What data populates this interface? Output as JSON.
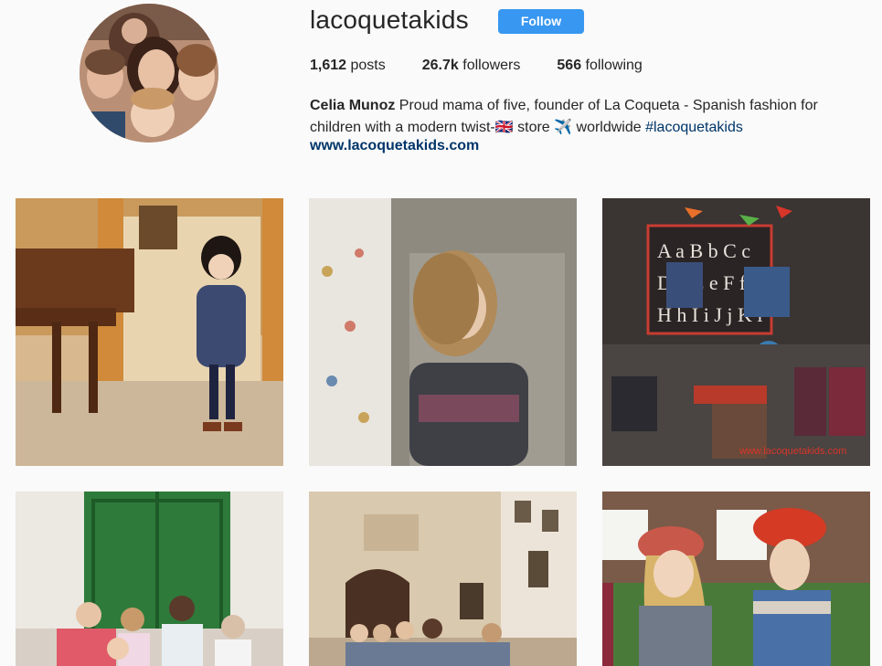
{
  "profile": {
    "username": "lacoquetakids",
    "follow_label": "Follow",
    "stats": [
      {
        "value": "1,612",
        "label": "posts"
      },
      {
        "value": "26.7k",
        "label": "followers"
      },
      {
        "value": "566",
        "label": "following"
      }
    ],
    "bio": {
      "name": "Celia Munoz",
      "text_1": "Proud mama of five, founder of La Coqueta - Spanish fashion for children with a modern twist-",
      "flag": "🇬🇧",
      "text_2": " store ",
      "plane": "✈️",
      "text_3": "  worldwide ",
      "hashtag": "#lacoquetakids"
    },
    "website": "www.lacoquetakids.com"
  },
  "posts": [
    {
      "caption": ""
    },
    {
      "caption": ""
    },
    {
      "caption": "www.lacoquetakids.com"
    },
    {
      "caption": ""
    },
    {
      "caption": ""
    },
    {
      "caption": ""
    }
  ],
  "colors": {
    "follow_button": "#3897f0",
    "link": "#003569",
    "background": "#fafafa"
  }
}
